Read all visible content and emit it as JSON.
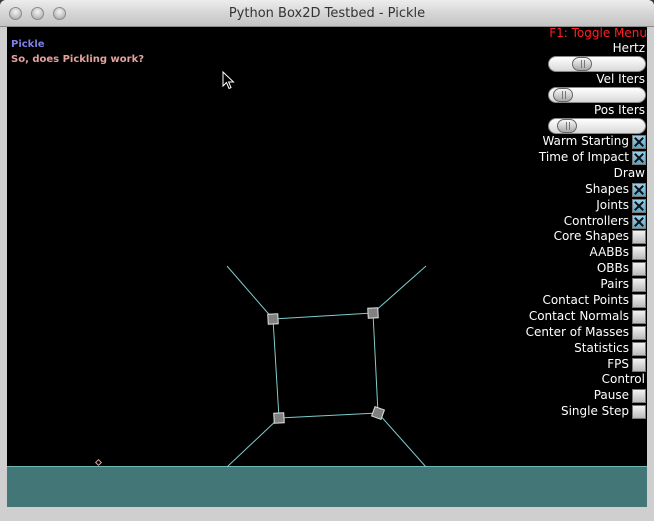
{
  "window": {
    "title": "Python Box2D Testbed - Pickle"
  },
  "info": {
    "test_name": "Pickle",
    "message": "So, does Pickling work?"
  },
  "menu": {
    "toggle_label": "F1: Toggle Menu",
    "sliders": [
      {
        "label": "Hertz",
        "level": 0.3
      },
      {
        "label": "Vel Iters",
        "level": 0.05
      },
      {
        "label": "Pos Iters",
        "level": 0.1
      }
    ],
    "checkboxes": [
      {
        "label": "Warm Starting",
        "checked": true
      },
      {
        "label": "Time of Impact",
        "checked": true
      }
    ],
    "draw_header": "Draw",
    "draw_items": [
      {
        "label": "Shapes",
        "checked": true
      },
      {
        "label": "Joints",
        "checked": true
      },
      {
        "label": "Controllers",
        "checked": true
      },
      {
        "label": "Core Shapes",
        "checked": false
      },
      {
        "label": "AABBs",
        "checked": false
      },
      {
        "label": "OBBs",
        "checked": false
      },
      {
        "label": "Pairs",
        "checked": false
      },
      {
        "label": "Contact Points",
        "checked": false
      },
      {
        "label": "Contact Normals",
        "checked": false
      },
      {
        "label": "Center of Masses",
        "checked": false
      },
      {
        "label": "Statistics",
        "checked": false
      },
      {
        "label": "FPS",
        "checked": false
      }
    ],
    "control_header": "Control",
    "control_items": [
      {
        "label": "Pause",
        "checked": false
      },
      {
        "label": "Single Step",
        "checked": false
      }
    ]
  },
  "colors": {
    "joint_line": "#7fcccc",
    "body_fill": "#808080",
    "ground_fill": "#437777",
    "info_title": "#7f7fe6",
    "info_message": "#e6a0a0",
    "menu_toggle": "#ff2020"
  }
}
